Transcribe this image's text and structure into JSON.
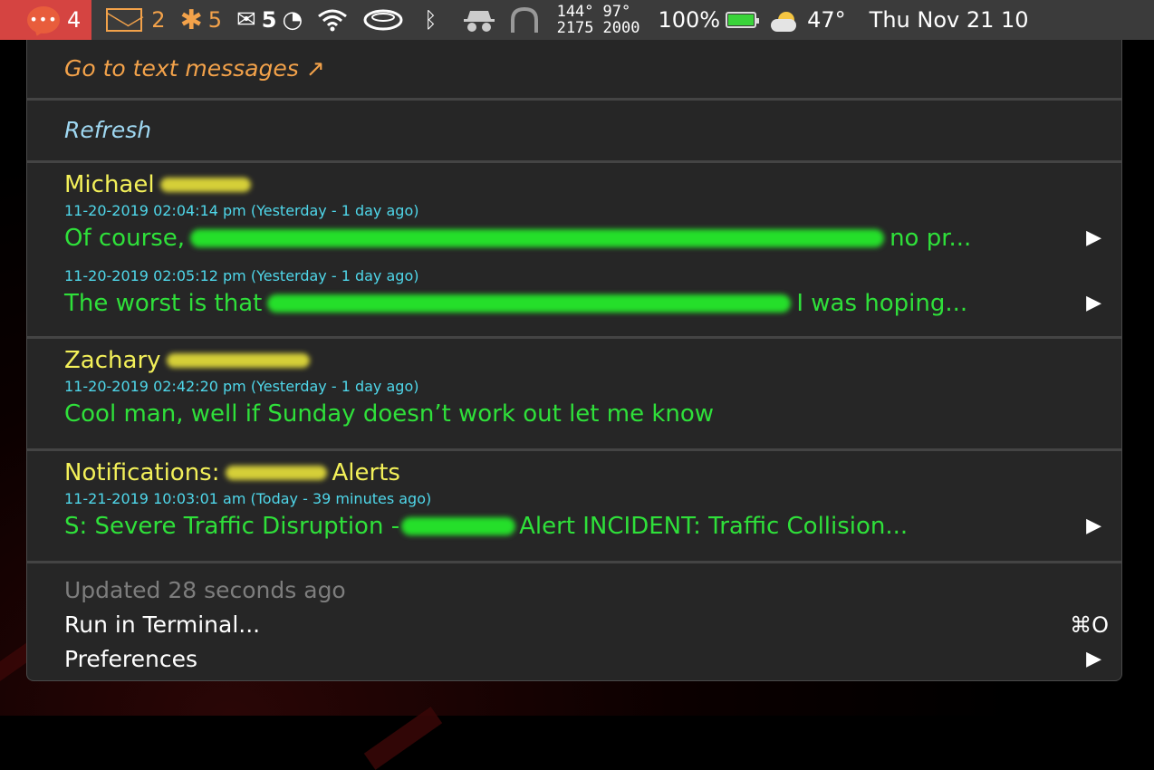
{
  "menubar": {
    "messages_count": "4",
    "mail_count": "2",
    "slack_count": "5",
    "gmail_count": "5",
    "stats": {
      "temp1": "144°",
      "temp2": "97°",
      "rpm1": "2175",
      "rpm2": "2000"
    },
    "battery_label": "100%",
    "weather": "47°",
    "clock": "Thu Nov 21 10"
  },
  "menu": {
    "go_to_messages": "Go to text messages ↗",
    "refresh": "Refresh",
    "threads": [
      {
        "sender": "Michael",
        "messages": [
          {
            "timestamp": "11-20-2019 02:04:14 pm (Yesterday - 1 day ago)",
            "text_start": "Of course,",
            "text_end": "no pr..."
          },
          {
            "timestamp": "11-20-2019 02:05:12 pm (Yesterday - 1 day ago)",
            "text_start": "The worst is that",
            "text_end": "I was hoping..."
          }
        ]
      },
      {
        "sender": "Zachary",
        "messages": [
          {
            "timestamp": "11-20-2019 02:42:20 pm (Yesterday - 1 day ago)",
            "text": "Cool man, well if Sunday doesn’t work out let me know"
          }
        ]
      },
      {
        "sender_start": "Notifications:",
        "sender_end": "Alerts",
        "messages": [
          {
            "timestamp": "11-21-2019 10:03:01 am (Today - 39 minutes ago)",
            "text_start": "S: Severe Traffic Disruption -",
            "text_end": "Alert INCIDENT:  Traffic Collision..."
          }
        ]
      }
    ],
    "updated": "Updated 28 seconds ago",
    "run_in_terminal": "Run in Terminal...",
    "run_shortcut": "⌘O",
    "preferences": "Preferences"
  },
  "colors": {
    "sender": "#f3f059",
    "timestamp": "#4fd7ea",
    "message": "#2fe03a",
    "link_orange": "#f3a24a",
    "link_blue": "#9fd8f2"
  }
}
